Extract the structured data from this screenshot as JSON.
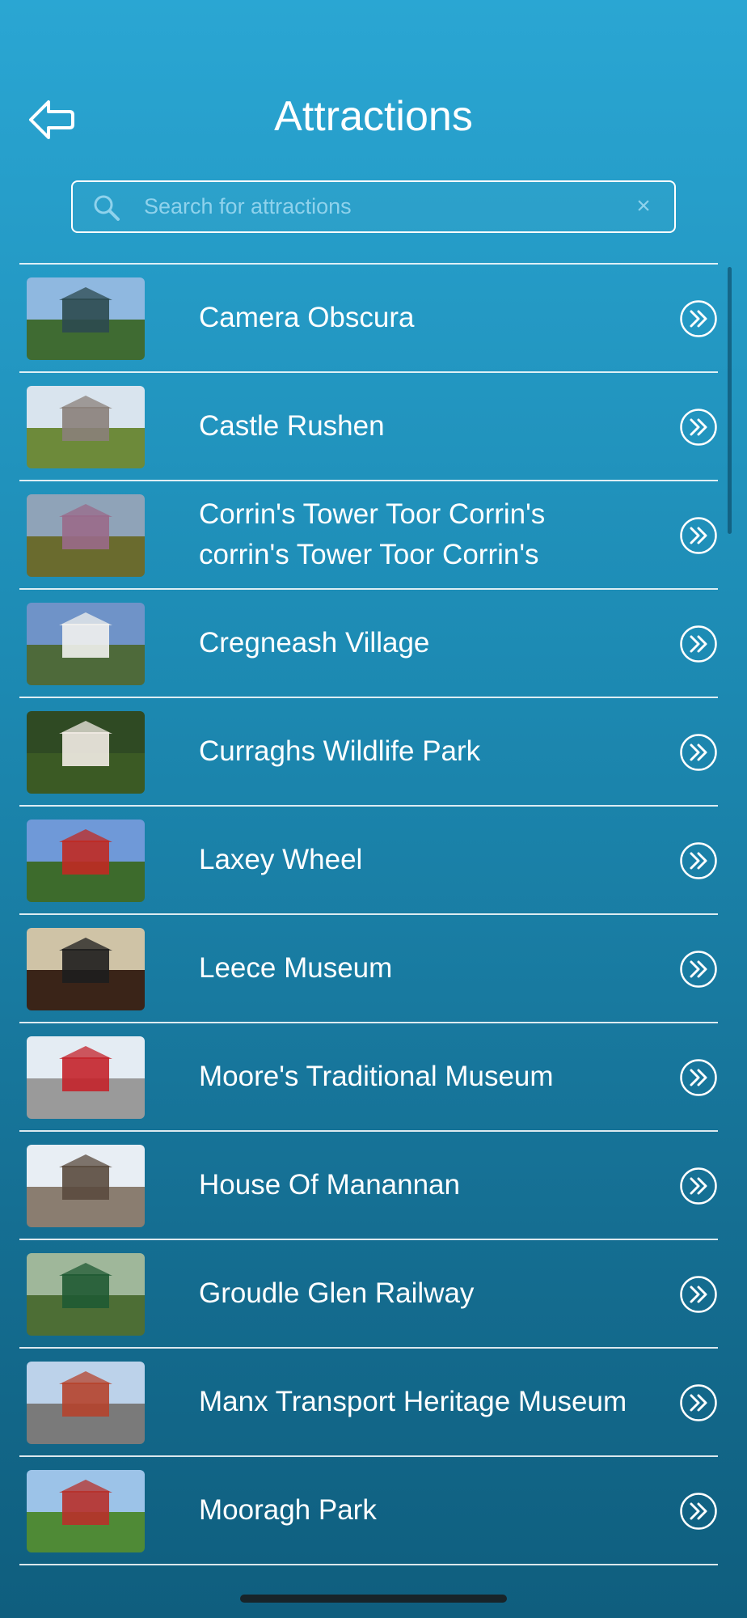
{
  "header": {
    "title": "Attractions",
    "back_icon": "back-arrow-icon"
  },
  "search": {
    "placeholder": "Search for attractions",
    "value": "",
    "icon": "search-icon",
    "clear_icon": "close-icon"
  },
  "attractions": [
    {
      "label": "Camera Obscura",
      "thumb": {
        "sky": "#8fb8e0",
        "ground": "#3f6b32",
        "accent": "#2c4a4f"
      }
    },
    {
      "label": "Castle Rushen",
      "thumb": {
        "sky": "#d9e4ee",
        "ground": "#6d8a3a",
        "accent": "#8a807a"
      }
    },
    {
      "label": "Corrin's Tower Toor Corrin's corrin's Tower Toor Corrin's",
      "thumb": {
        "sky": "#8fa3b8",
        "ground": "#6a6b2e",
        "accent": "#9a6a8a"
      }
    },
    {
      "label": "Cregneash Village",
      "thumb": {
        "sky": "#6f93c8",
        "ground": "#4e6a3a",
        "accent": "#f2f2ee"
      }
    },
    {
      "label": "Curraghs Wildlife Park",
      "thumb": {
        "sky": "#2f4a23",
        "ground": "#3b5a24",
        "accent": "#f3ece6"
      }
    },
    {
      "label": "Laxey Wheel",
      "thumb": {
        "sky": "#6f99d8",
        "ground": "#3d6b2c",
        "accent": "#c02a22"
      }
    },
    {
      "label": "Leece Museum",
      "thumb": {
        "sky": "#cfc3a6",
        "ground": "#3a2418",
        "accent": "#1e1e1e"
      }
    },
    {
      "label": "Moore's Traditional Museum",
      "thumb": {
        "sky": "#e4ecf3",
        "ground": "#9a9a9a",
        "accent": "#c4232b"
      }
    },
    {
      "label": "House Of Manannan",
      "thumb": {
        "sky": "#e8eef4",
        "ground": "#8a7d70",
        "accent": "#5a4a3e"
      }
    },
    {
      "label": "Groudle Glen Railway",
      "thumb": {
        "sky": "#9fb79a",
        "ground": "#4d6e35",
        "accent": "#1f5a33"
      }
    },
    {
      "label": "Manx Transport Heritage Museum",
      "thumb": {
        "sky": "#bcd2ea",
        "ground": "#7a7a7a",
        "accent": "#b5432c"
      }
    },
    {
      "label": "Mooragh Park",
      "thumb": {
        "sky": "#9cc3e8",
        "ground": "#4f8a36",
        "accent": "#b8302a"
      }
    }
  ],
  "row_arrow_icon": "double-chevron-right-circle-icon",
  "colors": {
    "background_top": "#2aa6d3",
    "background_bottom": "#0f5e7e",
    "text": "#ffffff",
    "placeholder": "#8fd2ec"
  }
}
